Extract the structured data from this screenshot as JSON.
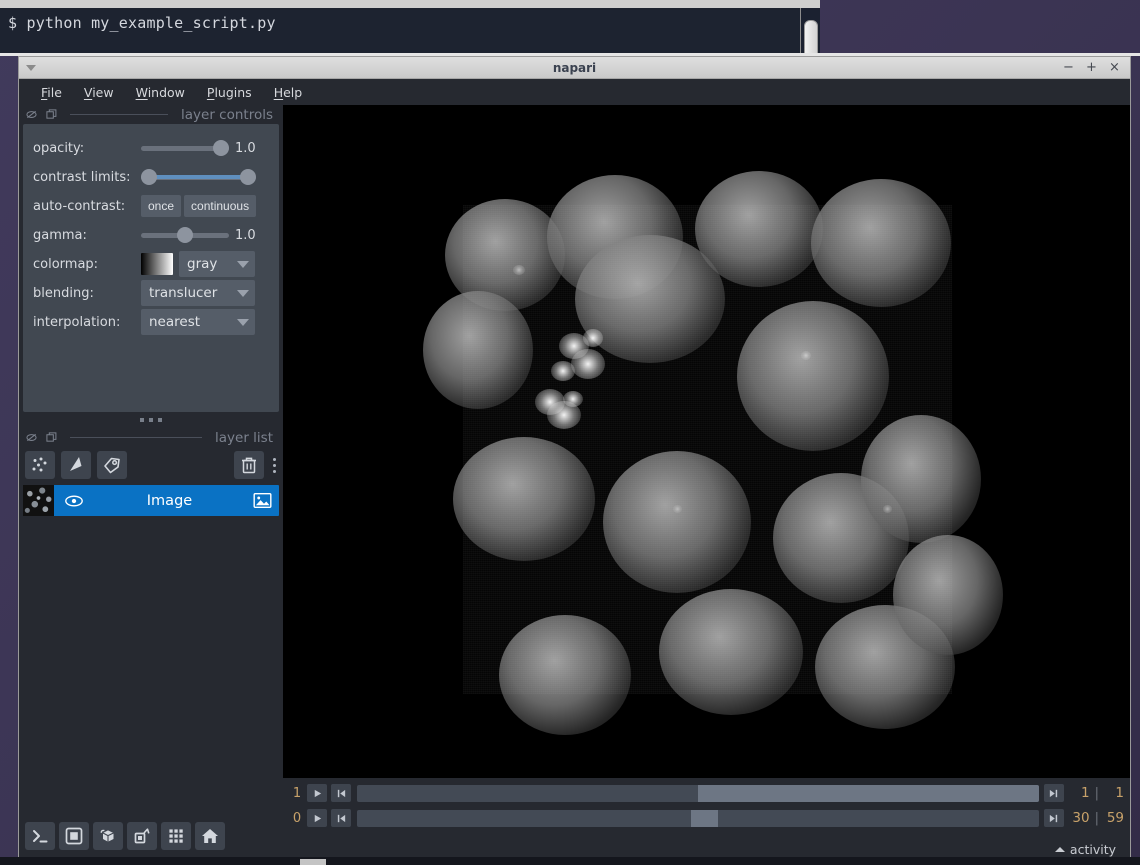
{
  "terminal": {
    "prompt": "$",
    "command": "python my_example_script.py",
    "line": "$ python my_example_script.py"
  },
  "window": {
    "title": "napari",
    "minimize_label": "−",
    "maximize_label": "+",
    "close_label": "×",
    "menu_arrow_icon": "caret-down-icon"
  },
  "menubar": {
    "items": [
      {
        "label": "File",
        "mnemonic": "F"
      },
      {
        "label": "View",
        "mnemonic": "V"
      },
      {
        "label": "Window",
        "mnemonic": "W"
      },
      {
        "label": "Plugins",
        "mnemonic": "P"
      },
      {
        "label": "Help",
        "mnemonic": "H"
      }
    ]
  },
  "layer_controls": {
    "dock_title": "layer controls",
    "dock_close_icon": "dock-close-icon",
    "dock_float_icon": "dock-float-icon",
    "opacity": {
      "label": "opacity:",
      "value": "1.00",
      "value_display": "1.0",
      "handle_percent": 88
    },
    "contrast_limits": {
      "label": "contrast limits:",
      "low_percent": 2,
      "high_percent": 98
    },
    "auto_contrast": {
      "label": "auto-contrast:",
      "once_label": "once",
      "continuous_label": "continuous"
    },
    "gamma": {
      "label": "gamma:",
      "value": "1.00",
      "value_display": "1.0",
      "handle_percent": 50
    },
    "colormap": {
      "label": "colormap:",
      "value": "gray",
      "swatch_icon": "gray-gradient-swatch",
      "arrow_icon": "chevron-down-icon"
    },
    "blending": {
      "label": "blending:",
      "value": "translucent",
      "value_display": "translucer",
      "arrow_icon": "chevron-down-icon"
    },
    "interpolation": {
      "label": "interpolation:",
      "value": "nearest",
      "arrow_icon": "chevron-down-icon"
    }
  },
  "layer_list": {
    "dock_title": "layer list",
    "dock_close_icon": "dock-close-icon",
    "dock_float_icon": "dock-float-icon",
    "buttons": [
      {
        "name": "new-points-layer-button",
        "icon": "points-icon"
      },
      {
        "name": "new-shapes-layer-button",
        "icon": "shapes-icon"
      },
      {
        "name": "new-labels-layer-button",
        "icon": "labels-tag-icon"
      }
    ],
    "delete_icon": "trash-icon",
    "overflow_icon": "kebab-menu-icon",
    "layers": [
      {
        "name": "Image",
        "selected": true,
        "visible": true,
        "visibility_icon": "eye-icon",
        "type_icon": "image-icon",
        "thumbnail": "nuclei-thumbnail"
      }
    ]
  },
  "viewer_buttons": [
    {
      "name": "console-button",
      "icon": "console-icon"
    },
    {
      "name": "ndisplay-toggle-button",
      "icon": "square-2d-icon"
    },
    {
      "name": "roll-dimensions-button",
      "icon": "cube-roll-icon"
    },
    {
      "name": "transpose-dimensions-button",
      "icon": "transpose-icon"
    },
    {
      "name": "grid-view-button",
      "icon": "grid-icon"
    },
    {
      "name": "home-reset-view-button",
      "icon": "home-icon"
    }
  ],
  "dims": {
    "rows": [
      {
        "axis": "1",
        "current": "1",
        "max": "1",
        "thumb_left_percent": 50,
        "thumb_width_percent": 50,
        "play_icon": "play-icon",
        "step_back_icon": "step-back-icon",
        "step_forward_icon": "step-forward-icon"
      },
      {
        "axis": "0",
        "current": "30",
        "max": "59",
        "thumb_left_percent": 49,
        "thumb_width_percent": 4,
        "play_icon": "play-icon",
        "step_back_icon": "step-back-icon",
        "step_forward_icon": "step-forward-icon"
      }
    ],
    "separator": "|"
  },
  "statusbar": {
    "activity_label": "activity",
    "activity_caret_icon": "caret-up-icon"
  },
  "canvas": {
    "image_name": "nuclei-micrograph",
    "description": "grayscale fluorescence micrograph of cell nuclei"
  },
  "colors": {
    "window_bg": "#262930",
    "panel_bg": "#414851",
    "selection_blue": "#0a72c4",
    "accent_yellow": "#c8a26a",
    "titlebar": "#d4d4d4",
    "desktop": "#3b3453",
    "terminal_bg": "#1d2330"
  }
}
